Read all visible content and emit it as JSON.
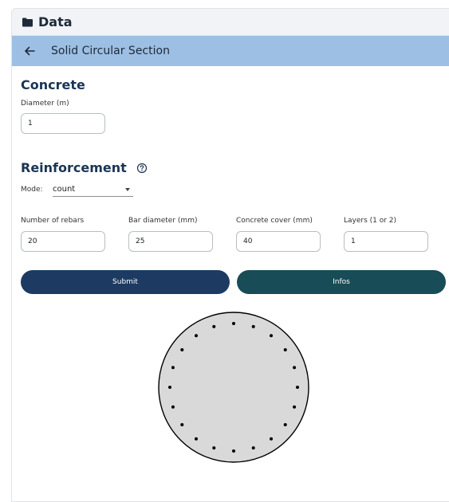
{
  "header": {
    "title": "Data",
    "icon": "folder-icon"
  },
  "section_bar": {
    "back_icon": "arrow-left-icon",
    "title": "Solid Circular Section",
    "color": "#9dbfe3"
  },
  "concrete": {
    "heading": "Concrete",
    "diameter": {
      "label": "Diameter (m)",
      "value": "1"
    }
  },
  "reinforcement": {
    "heading": "Reinforcement",
    "help_icon": "help-circle-icon",
    "mode": {
      "label": "Mode:",
      "value": "count"
    },
    "fields": [
      {
        "label": "Number of rebars",
        "value": "20"
      },
      {
        "label": "Bar diameter (mm)",
        "value": "25"
      },
      {
        "label": "Concrete cover (mm)",
        "value": "40"
      },
      {
        "label": "Layers (1 or 2)",
        "value": "1"
      }
    ]
  },
  "buttons": {
    "submit": {
      "label": "Submit",
      "color": "#1d3a63"
    },
    "infos": {
      "label": "Infos",
      "color": "#184c56"
    }
  },
  "preview": {
    "rebar_count": 20,
    "section_fill": "#d9d9d9"
  }
}
